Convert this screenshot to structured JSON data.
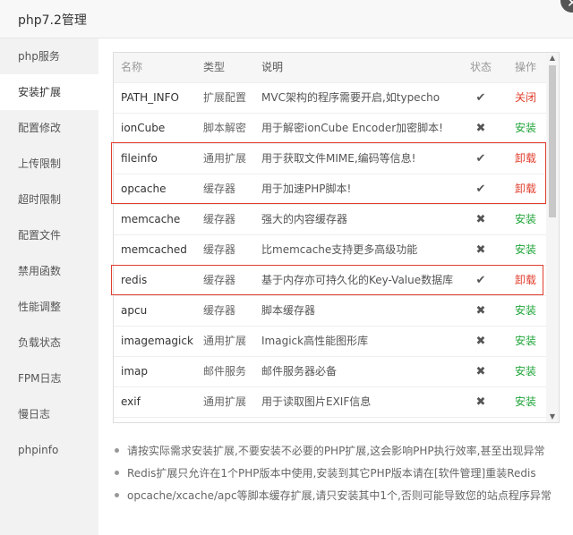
{
  "dialog": {
    "title": "php7.2管理",
    "close_glyph": "✕"
  },
  "sidebar": {
    "items": [
      {
        "label": "php服务"
      },
      {
        "label": "安装扩展",
        "active": true
      },
      {
        "label": "配置修改"
      },
      {
        "label": "上传限制"
      },
      {
        "label": "超时限制"
      },
      {
        "label": "配置文件"
      },
      {
        "label": "禁用函数"
      },
      {
        "label": "性能调整"
      },
      {
        "label": "负载状态"
      },
      {
        "label": "FPM日志"
      },
      {
        "label": "慢日志"
      },
      {
        "label": "phpinfo"
      }
    ]
  },
  "table": {
    "headers": {
      "name": "名称",
      "type": "类型",
      "desc": "说明",
      "status": "状态",
      "op": "操作"
    },
    "rows": [
      {
        "name": "PATH_INFO",
        "type": "扩展配置",
        "desc": "MVC架构的程序需要开启,如typecho",
        "status": "✔",
        "status_icon": "check-icon",
        "op": "关闭",
        "op_kind": "close"
      },
      {
        "name": "ionCube",
        "type": "脚本解密",
        "desc": "用于解密ionCube Encoder加密脚本!",
        "status": "✖",
        "status_icon": "cross-icon",
        "op": "安装",
        "op_kind": "install"
      },
      {
        "name": "fileinfo",
        "type": "通用扩展",
        "desc": "用于获取文件MIME,编码等信息!",
        "status": "✔",
        "status_icon": "check-icon",
        "op": "卸载",
        "op_kind": "uninstall"
      },
      {
        "name": "opcache",
        "type": "缓存器",
        "desc": "用于加速PHP脚本!",
        "status": "✔",
        "status_icon": "check-icon",
        "op": "卸载",
        "op_kind": "uninstall"
      },
      {
        "name": "memcache",
        "type": "缓存器",
        "desc": "强大的内容缓存器",
        "status": "✖",
        "status_icon": "cross-icon",
        "op": "安装",
        "op_kind": "install"
      },
      {
        "name": "memcached",
        "type": "缓存器",
        "desc": "比memcache支持更多高级功能",
        "status": "✖",
        "status_icon": "cross-icon",
        "op": "安装",
        "op_kind": "install"
      },
      {
        "name": "redis",
        "type": "缓存器",
        "desc": "基于内存亦可持久化的Key-Value数据库",
        "status": "✔",
        "status_icon": "check-icon",
        "op": "卸载",
        "op_kind": "uninstall"
      },
      {
        "name": "apcu",
        "type": "缓存器",
        "desc": "脚本缓存器",
        "status": "✖",
        "status_icon": "cross-icon",
        "op": "安装",
        "op_kind": "install"
      },
      {
        "name": "imagemagick",
        "type": "通用扩展",
        "desc": "Imagick高性能图形库",
        "status": "✖",
        "status_icon": "cross-icon",
        "op": "安装",
        "op_kind": "install"
      },
      {
        "name": "imap",
        "type": "邮件服务",
        "desc": "邮件服务器必备",
        "status": "✖",
        "status_icon": "cross-icon",
        "op": "安装",
        "op_kind": "install"
      },
      {
        "name": "exif",
        "type": "通用扩展",
        "desc": "用于读取图片EXIF信息",
        "status": "✖",
        "status_icon": "cross-icon",
        "op": "安装",
        "op_kind": "install"
      }
    ]
  },
  "notes": [
    "请按实际需求安装扩展,不要安装不必要的PHP扩展,这会影响PHP执行效率,甚至出现异常",
    "Redis扩展只允许在1个PHP版本中使用,安装到其它PHP版本请在[软件管理]重装Redis",
    "opcache/xcache/apc等脚本缓存扩展,请只安装其中1个,否则可能导致您的站点程序异常"
  ],
  "colors": {
    "install": "#20a53a",
    "uninstall": "#e03e2d",
    "highlight": "#e03e2d"
  }
}
